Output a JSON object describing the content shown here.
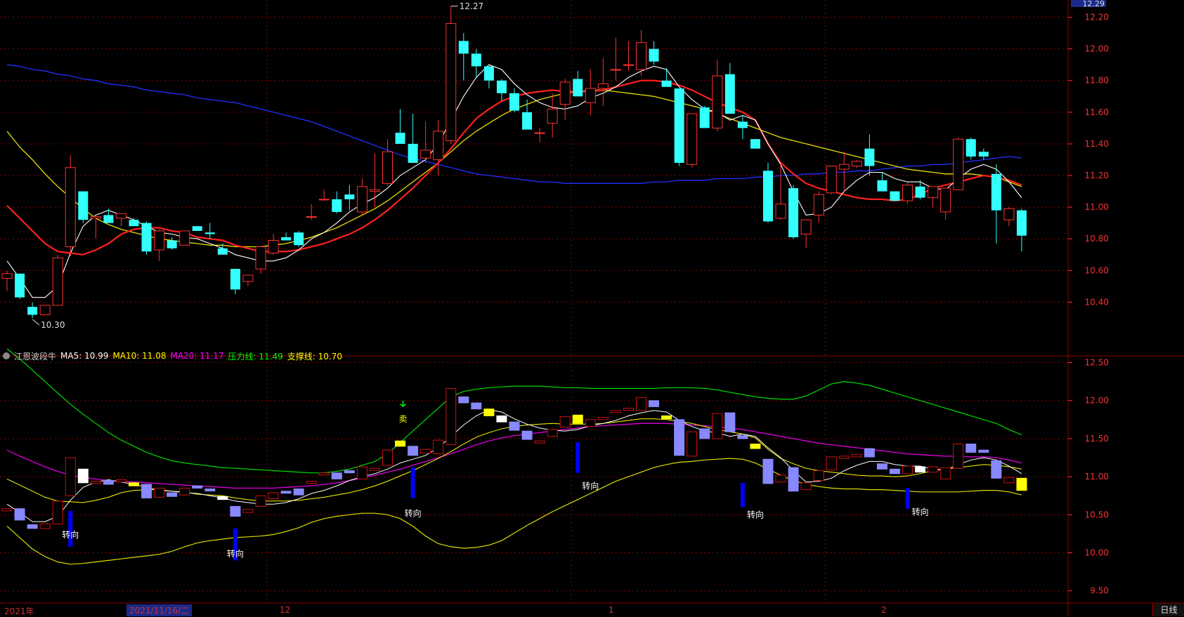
{
  "indicator": {
    "name": "江恩波段牛",
    "items": [
      {
        "label": "MA5: 10.99",
        "color": "#ffffff"
      },
      {
        "label": "MA10: 11.08",
        "color": "#ffff00"
      },
      {
        "label": "MA20: 11.17",
        "color": "#ff00ff"
      },
      {
        "label": "压力线: 11.49",
        "color": "#00ff00"
      },
      {
        "label": "支撑线: 10.70",
        "color": "#ffff00"
      }
    ]
  },
  "date_axis": {
    "year": "2021年",
    "selected": "2021/11/16/二",
    "months": [
      "12",
      "1",
      "2"
    ]
  },
  "period_button": "日线",
  "colors": {
    "up": "#ff3030",
    "down": "#33ffff",
    "ma5": "#ffffff",
    "ma10": "#ff2020",
    "ma20": "#e8e000",
    "ma60": "#2030ff",
    "grid": "#8b0000",
    "axis_text": "#ff3030",
    "sub_up": "#cc1111",
    "sub_down": "#8888ff",
    "sub_white": "#ffffff",
    "sub_yellow": "#ffff00",
    "pressure": "#00dd00",
    "support": "#dddd00",
    "sub_ma20": "#dd00dd",
    "turn_bar": "#0000ff"
  },
  "chart_data": [
    {
      "type": "candlestick",
      "name": "main",
      "yticks": [
        10.4,
        10.6,
        10.8,
        11.0,
        11.2,
        11.4,
        11.6,
        11.8,
        12.0,
        12.2
      ],
      "ylim": [
        10.26,
        12.3
      ],
      "top_price_label": "12.29",
      "annotations": [
        {
          "text": "12.27",
          "index": 35,
          "price": 12.27
        },
        {
          "text": "10.30",
          "index": 2,
          "price": 10.3
        }
      ],
      "candles": [
        [
          10.55,
          10.6,
          10.47,
          10.58
        ],
        [
          10.58,
          10.58,
          10.42,
          10.43
        ],
        [
          10.37,
          10.4,
          10.3,
          10.32
        ],
        [
          10.32,
          10.38,
          10.32,
          10.38
        ],
        [
          10.38,
          10.7,
          10.38,
          10.68
        ],
        [
          10.75,
          11.33,
          10.69,
          11.25
        ],
        [
          11.1,
          11.1,
          10.9,
          10.92
        ],
        [
          10.93,
          10.94,
          10.8,
          10.94
        ],
        [
          10.95,
          10.99,
          10.9,
          10.9
        ],
        [
          10.93,
          10.96,
          10.88,
          10.96
        ],
        [
          10.92,
          10.93,
          10.88,
          10.88
        ],
        [
          10.9,
          10.91,
          10.7,
          10.72
        ],
        [
          10.73,
          10.86,
          10.66,
          10.85
        ],
        [
          10.79,
          10.81,
          10.73,
          10.74
        ],
        [
          10.76,
          10.85,
          10.76,
          10.85
        ],
        [
          10.88,
          10.88,
          10.85,
          10.85
        ],
        [
          10.84,
          10.9,
          10.8,
          10.83
        ],
        [
          10.74,
          10.77,
          10.7,
          10.7
        ],
        [
          10.61,
          10.61,
          10.45,
          10.48
        ],
        [
          10.53,
          10.57,
          10.5,
          10.57
        ],
        [
          10.61,
          10.75,
          10.58,
          10.75
        ],
        [
          10.71,
          10.83,
          10.7,
          10.79
        ],
        [
          10.81,
          10.84,
          10.79,
          10.79
        ],
        [
          10.84,
          10.85,
          10.75,
          10.76
        ],
        [
          10.94,
          11.02,
          10.92,
          10.94
        ],
        [
          11.05,
          11.11,
          11.04,
          11.05
        ],
        [
          11.05,
          11.1,
          10.96,
          10.97
        ],
        [
          11.08,
          11.14,
          10.98,
          11.05
        ],
        [
          10.97,
          11.18,
          10.95,
          11.13
        ],
        [
          11.1,
          11.34,
          11.0,
          11.11
        ],
        [
          11.15,
          11.43,
          11.14,
          11.35
        ],
        [
          11.47,
          11.62,
          11.4,
          11.4
        ],
        [
          11.4,
          11.59,
          11.31,
          11.28
        ],
        [
          11.31,
          11.54,
          11.28,
          11.36
        ],
        [
          11.3,
          11.55,
          11.2,
          11.48
        ],
        [
          11.42,
          12.27,
          11.4,
          12.16
        ],
        [
          12.05,
          12.1,
          11.8,
          11.97
        ],
        [
          11.97,
          12.0,
          11.82,
          11.89
        ],
        [
          11.89,
          11.89,
          11.75,
          11.8
        ],
        [
          11.8,
          11.81,
          11.67,
          11.72
        ],
        [
          11.72,
          11.75,
          11.6,
          11.61
        ],
        [
          11.6,
          11.68,
          11.5,
          11.49
        ],
        [
          11.47,
          11.5,
          11.41,
          11.47
        ],
        [
          11.53,
          11.72,
          11.44,
          11.62
        ],
        [
          11.65,
          11.81,
          11.55,
          11.79
        ],
        [
          11.81,
          11.86,
          11.73,
          11.7
        ],
        [
          11.66,
          11.87,
          11.58,
          11.75
        ],
        [
          11.75,
          11.94,
          11.64,
          11.78
        ],
        [
          11.87,
          12.07,
          11.8,
          11.87
        ],
        [
          11.9,
          12.05,
          11.86,
          11.9
        ],
        [
          11.87,
          12.12,
          11.83,
          12.04
        ],
        [
          12.0,
          12.05,
          11.9,
          11.92
        ],
        [
          11.8,
          11.88,
          11.76,
          11.76
        ],
        [
          11.75,
          11.75,
          11.26,
          11.28
        ],
        [
          11.27,
          11.51,
          11.25,
          11.59
        ],
        [
          11.63,
          11.64,
          11.5,
          11.5
        ],
        [
          11.5,
          11.93,
          11.48,
          11.83
        ],
        [
          11.84,
          11.91,
          11.61,
          11.59
        ],
        [
          11.54,
          11.58,
          11.43,
          11.5
        ],
        [
          11.43,
          11.43,
          11.37,
          11.37
        ],
        [
          11.23,
          11.28,
          10.9,
          10.91
        ],
        [
          10.93,
          11.27,
          10.92,
          11.02
        ],
        [
          11.12,
          11.14,
          10.8,
          10.81
        ],
        [
          10.83,
          10.9,
          10.74,
          10.92
        ],
        [
          10.95,
          11.1,
          10.9,
          11.08
        ],
        [
          11.09,
          11.26,
          11.08,
          11.26
        ],
        [
          11.24,
          11.35,
          11.1,
          11.27
        ],
        [
          11.26,
          11.3,
          11.25,
          11.29
        ],
        [
          11.37,
          11.46,
          11.2,
          11.26
        ],
        [
          11.17,
          11.22,
          11.1,
          11.1
        ],
        [
          11.1,
          11.1,
          11.05,
          11.04
        ],
        [
          11.04,
          11.16,
          11.02,
          11.14
        ],
        [
          11.13,
          11.17,
          11.05,
          11.06
        ],
        [
          11.06,
          11.13,
          11.0,
          11.13
        ],
        [
          10.97,
          11.12,
          10.92,
          11.12
        ],
        [
          11.11,
          11.44,
          11.11,
          11.43
        ],
        [
          11.43,
          11.44,
          11.3,
          11.32
        ],
        [
          11.35,
          11.37,
          11.3,
          11.32
        ],
        [
          11.21,
          11.27,
          10.77,
          10.98
        ],
        [
          10.92,
          11.0,
          10.88,
          10.99
        ],
        [
          10.98,
          10.99,
          10.72,
          10.82
        ]
      ],
      "ma5": [
        10.66,
        10.55,
        10.43,
        10.43,
        10.5,
        10.71,
        10.88,
        10.95,
        10.98,
        10.95,
        10.92,
        10.88,
        10.84,
        10.83,
        10.81,
        10.8,
        10.77,
        10.74,
        10.7,
        10.68,
        10.66,
        10.66,
        10.68,
        10.73,
        10.8,
        10.84,
        10.9,
        10.97,
        11.02,
        11.06,
        11.12,
        11.2,
        11.25,
        11.3,
        11.4,
        11.55,
        11.7,
        11.82,
        11.9,
        11.87,
        11.78,
        11.71,
        11.66,
        11.63,
        11.62,
        11.64,
        11.69,
        11.72,
        11.76,
        11.82,
        11.86,
        11.89,
        11.87,
        11.76,
        11.68,
        11.62,
        11.6,
        11.55,
        11.58,
        11.55,
        11.4,
        11.27,
        11.1,
        10.95,
        10.96,
        11.0,
        11.1,
        11.17,
        11.22,
        11.22,
        11.18,
        11.16,
        11.16,
        11.12,
        11.11,
        11.18,
        11.24,
        11.27,
        11.24,
        11.16,
        11.06
      ],
      "ma10": [
        11.01,
        10.93,
        10.85,
        10.77,
        10.72,
        10.71,
        10.7,
        10.73,
        10.77,
        10.83,
        10.86,
        10.87,
        10.87,
        10.85,
        10.84,
        10.81,
        10.8,
        10.79,
        10.76,
        10.74,
        10.72,
        10.72,
        10.72,
        10.73,
        10.75,
        10.77,
        10.8,
        10.83,
        10.87,
        10.92,
        10.98,
        11.05,
        11.12,
        11.2,
        11.28,
        11.37,
        11.47,
        11.56,
        11.62,
        11.67,
        11.7,
        11.72,
        11.73,
        11.74,
        11.73,
        11.73,
        11.73,
        11.74,
        11.76,
        11.78,
        11.8,
        11.8,
        11.79,
        11.77,
        11.74,
        11.7,
        11.66,
        11.63,
        11.6,
        11.55,
        11.4,
        11.28,
        11.21,
        11.15,
        11.12,
        11.1,
        11.08,
        11.06,
        11.05,
        11.05,
        11.04,
        11.05,
        11.08,
        11.12,
        11.14,
        11.16,
        11.18,
        11.2,
        11.19,
        11.17,
        11.14
      ],
      "ma20": [
        11.48,
        11.38,
        11.3,
        11.21,
        11.13,
        11.06,
        10.99,
        10.93,
        10.89,
        10.86,
        10.84,
        10.82,
        10.8,
        10.79,
        10.78,
        10.77,
        10.76,
        10.76,
        10.75,
        10.75,
        10.75,
        10.76,
        10.77,
        10.79,
        10.81,
        10.84,
        10.87,
        10.91,
        10.95,
        10.99,
        11.04,
        11.1,
        11.16,
        11.22,
        11.28,
        11.35,
        11.42,
        11.48,
        11.53,
        11.58,
        11.62,
        11.65,
        11.68,
        11.7,
        11.72,
        11.73,
        11.74,
        11.74,
        11.73,
        11.72,
        11.71,
        11.7,
        11.68,
        11.66,
        11.64,
        11.62,
        11.59,
        11.56,
        11.53,
        11.5,
        11.47,
        11.44,
        11.42,
        11.4,
        11.38,
        11.36,
        11.34,
        11.32,
        11.3,
        11.28,
        11.26,
        11.24,
        11.23,
        11.22,
        11.21,
        11.21,
        11.21,
        11.2,
        11.19,
        11.16,
        11.13
      ],
      "ma60": [
        11.9,
        11.89,
        11.87,
        11.86,
        11.84,
        11.83,
        11.81,
        11.8,
        11.78,
        11.77,
        11.76,
        11.74,
        11.73,
        11.72,
        11.71,
        11.69,
        11.68,
        11.67,
        11.66,
        11.64,
        11.62,
        11.6,
        11.58,
        11.56,
        11.54,
        11.51,
        11.48,
        11.45,
        11.42,
        11.39,
        11.36,
        11.33,
        11.31,
        11.29,
        11.27,
        11.25,
        11.23,
        11.21,
        11.2,
        11.19,
        11.18,
        11.17,
        11.16,
        11.16,
        11.15,
        11.15,
        11.15,
        11.15,
        11.15,
        11.15,
        11.15,
        11.16,
        11.16,
        11.17,
        11.17,
        11.17,
        11.18,
        11.18,
        11.18,
        11.19,
        11.19,
        11.2,
        11.2,
        11.21,
        11.21,
        11.22,
        11.22,
        11.23,
        11.23,
        11.24,
        11.25,
        11.26,
        11.26,
        11.27,
        11.27,
        11.28,
        11.29,
        11.3,
        11.31,
        11.32,
        11.31
      ]
    },
    {
      "type": "indicator",
      "name": "江恩波段牛",
      "yticks": [
        9.5,
        10.0,
        10.5,
        11.0,
        11.5,
        12.0,
        12.5
      ],
      "ylim": [
        9.35,
        12.8
      ],
      "pressure": [
        12.68,
        12.55,
        12.4,
        12.25,
        12.1,
        11.95,
        11.82,
        11.7,
        11.58,
        11.48,
        11.4,
        11.32,
        11.26,
        11.21,
        11.18,
        11.16,
        11.14,
        11.12,
        11.11,
        11.1,
        11.09,
        11.08,
        11.07,
        11.06,
        11.05,
        11.05,
        11.07,
        11.1,
        11.15,
        11.2,
        11.3,
        11.45,
        11.6,
        11.75,
        11.9,
        12.05,
        12.12,
        12.15,
        12.17,
        12.18,
        12.19,
        12.19,
        12.19,
        12.18,
        12.17,
        12.17,
        12.16,
        12.16,
        12.16,
        12.16,
        12.16,
        12.16,
        12.17,
        12.17,
        12.17,
        12.16,
        12.14,
        12.11,
        12.08,
        12.05,
        12.03,
        12.02,
        12.02,
        12.06,
        12.14,
        12.22,
        12.25,
        12.23,
        12.2,
        12.15,
        12.1,
        12.05,
        12.0,
        11.95,
        11.9,
        11.85,
        11.8,
        11.75,
        11.7,
        11.62,
        11.55
      ],
      "support": [
        10.35,
        10.2,
        10.05,
        9.95,
        9.88,
        9.85,
        9.86,
        9.88,
        9.9,
        9.92,
        9.94,
        9.96,
        9.98,
        10.02,
        10.08,
        10.13,
        10.16,
        10.18,
        10.2,
        10.21,
        10.22,
        10.24,
        10.28,
        10.33,
        10.4,
        10.45,
        10.48,
        10.5,
        10.52,
        10.52,
        10.5,
        10.45,
        10.35,
        10.22,
        10.12,
        10.08,
        10.06,
        10.07,
        10.1,
        10.16,
        10.26,
        10.36,
        10.45,
        10.54,
        10.62,
        10.7,
        10.78,
        10.86,
        10.94,
        11.0,
        11.06,
        11.12,
        11.16,
        11.19,
        11.2,
        11.22,
        11.23,
        11.24,
        11.23,
        11.18,
        11.1,
        11.02,
        10.95,
        10.9,
        10.87,
        10.85,
        10.84,
        10.84,
        10.83,
        10.83,
        10.82,
        10.81,
        10.8,
        10.8,
        10.8,
        10.8,
        10.81,
        10.82,
        10.82,
        10.8,
        10.76
      ],
      "ma20": [
        11.35,
        11.27,
        11.2,
        11.13,
        11.07,
        11.02,
        10.99,
        10.97,
        10.95,
        10.94,
        10.93,
        10.92,
        10.91,
        10.9,
        10.89,
        10.88,
        10.87,
        10.86,
        10.85,
        10.85,
        10.85,
        10.85,
        10.86,
        10.87,
        10.88,
        10.9,
        10.92,
        10.95,
        10.98,
        11.02,
        11.06,
        11.1,
        11.15,
        11.2,
        11.25,
        11.3,
        11.36,
        11.42,
        11.47,
        11.51,
        11.54,
        11.56,
        11.58,
        11.6,
        11.62,
        11.64,
        11.66,
        11.67,
        11.68,
        11.69,
        11.7,
        11.7,
        11.7,
        11.69,
        11.68,
        11.67,
        11.66,
        11.64,
        11.62,
        11.59,
        11.56,
        11.53,
        11.5,
        11.47,
        11.44,
        11.42,
        11.4,
        11.38,
        11.36,
        11.34,
        11.32,
        11.3,
        11.29,
        11.28,
        11.27,
        11.27,
        11.26,
        11.26,
        11.25,
        11.22,
        11.18
      ]
    }
  ],
  "sub_markers": [
    {
      "text": "卖",
      "index": 31
    },
    {
      "text": "转向",
      "index": 5
    },
    {
      "text": "转向",
      "index": 18
    },
    {
      "text": "转向",
      "index": 32
    },
    {
      "text": "转向",
      "index": 46
    },
    {
      "text": "转向",
      "index": 59
    },
    {
      "text": "转向",
      "index": 72
    }
  ],
  "turn_bars": [
    {
      "index": 5,
      "top": 10.55,
      "bottom": 10.08
    },
    {
      "index": 18,
      "top": 10.32,
      "bottom": 9.9
    },
    {
      "index": 32,
      "top": 11.12,
      "bottom": 10.72
    },
    {
      "index": 45,
      "top": 11.45,
      "bottom": 11.05
    },
    {
      "index": 58,
      "top": 10.92,
      "bottom": 10.6
    },
    {
      "index": 71,
      "top": 10.85,
      "bottom": 10.58
    }
  ]
}
